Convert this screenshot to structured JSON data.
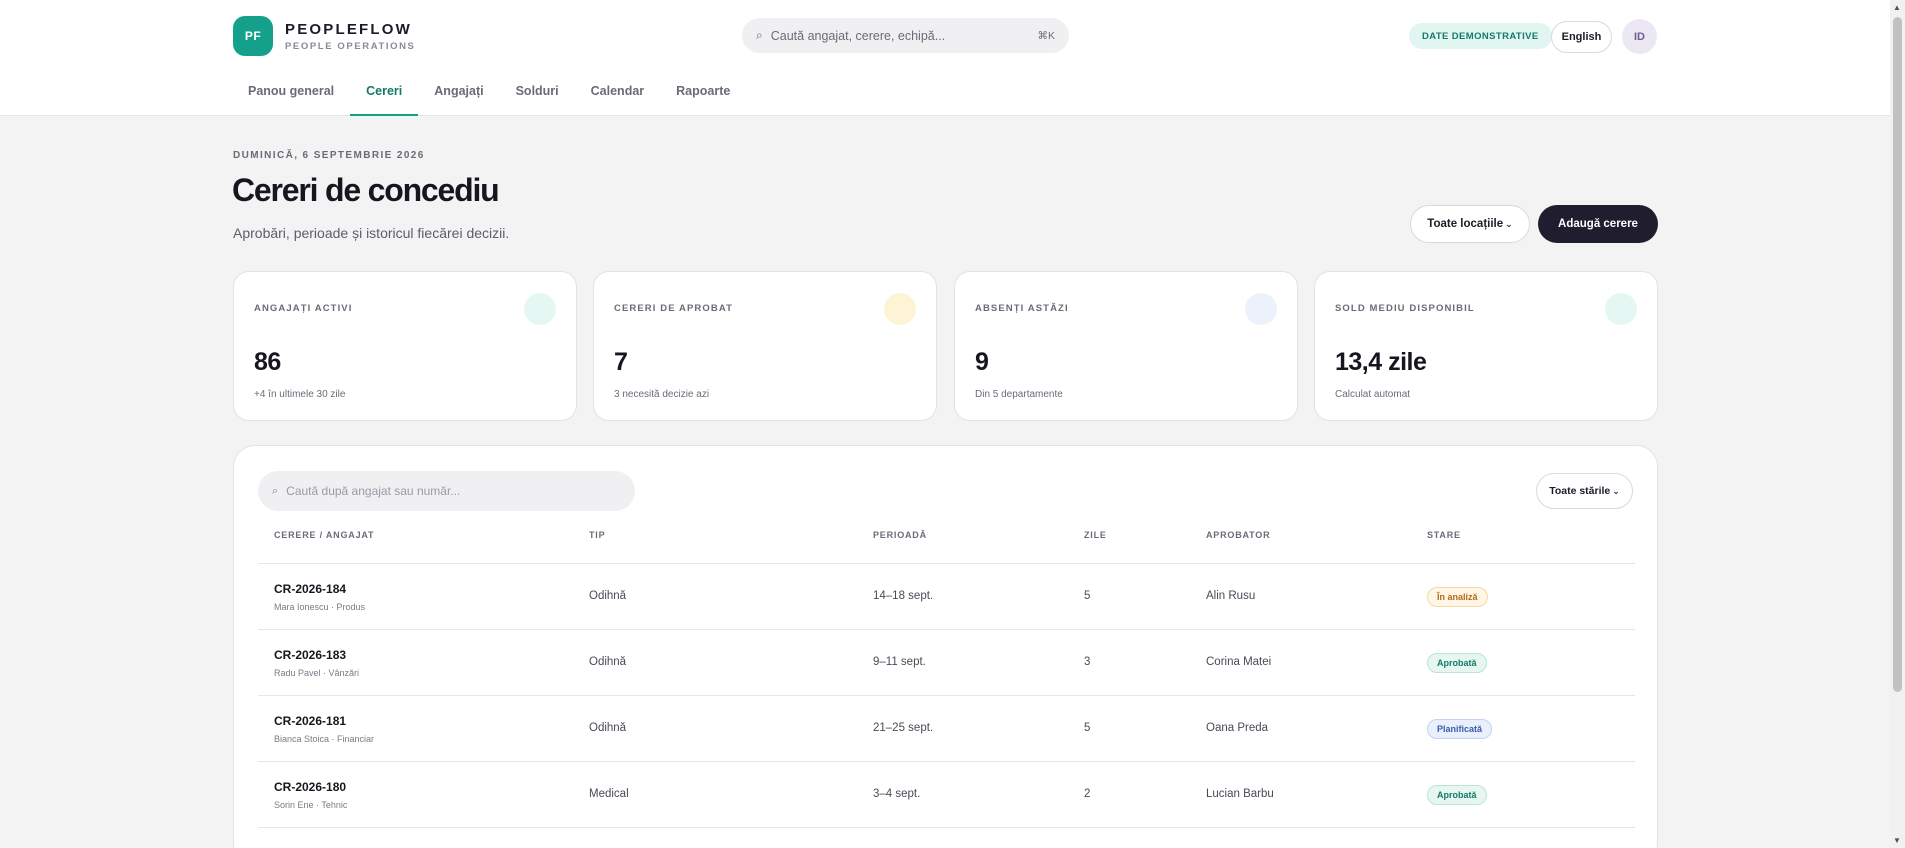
{
  "brand": {
    "logo": "PF",
    "name": "PEOPLEFLOW",
    "subtitle": "PEOPLE OPERATIONS"
  },
  "header": {
    "search_placeholder": "Caută angajat, cerere, echipă...",
    "search_shortcut": "⌘K",
    "demo_badge": "DATE DEMONSTRATIVE",
    "language": "English",
    "avatar": "ID"
  },
  "nav": [
    "Panou general",
    "Cereri",
    "Angajați",
    "Solduri",
    "Calendar",
    "Rapoarte"
  ],
  "nav_active": "Cereri",
  "page": {
    "date": "DUMINICĂ, 6 SEPTEMBRIE 2026",
    "title": "Cereri de concediu",
    "subtitle": "Aprobări, perioade și istoricul fiecărei decizii.",
    "locations_button": "Toate locațiile",
    "add_button": "Adaugă cerere"
  },
  "stats": [
    {
      "label": "ANGAJAȚI ACTIVI",
      "value": "86",
      "note": "+4 în ultimele 30 zile",
      "color": "#e5f7f2"
    },
    {
      "label": "CERERI DE APROBAT",
      "value": "7",
      "note": "3 necesită decizie azi",
      "color": "#fdf4d6"
    },
    {
      "label": "ABSENȚI ASTĂZI",
      "value": "9",
      "note": "Din 5 departamente",
      "color": "#ecf1fb"
    },
    {
      "label": "SOLD MEDIU DISPONIBIL",
      "value": "13,4 zile",
      "note": "Calculat automat",
      "color": "#e5f7f2"
    }
  ],
  "table": {
    "search_placeholder": "Caută după angajat sau număr...",
    "status_filter": "Toate stările",
    "columns": [
      "CERERE / ANGAJAT",
      "TIP",
      "PERIOADĂ",
      "ZILE",
      "APROBATOR",
      "STARE"
    ],
    "rows": [
      {
        "id": "CR-2026-184",
        "employee": "Mara Ionescu · Produs",
        "type": "Odihnă",
        "period": "14–18 sept.",
        "days": "5",
        "approver": "Alin Rusu",
        "status": "În analiză"
      },
      {
        "id": "CR-2026-183",
        "employee": "Radu Pavel · Vânzări",
        "type": "Odihnă",
        "period": "9–11 sept.",
        "days": "3",
        "approver": "Corina Matei",
        "status": "Aprobată"
      },
      {
        "id": "CR-2026-181",
        "employee": "Bianca Stoica · Financiar",
        "type": "Odihnă",
        "period": "21–25 sept.",
        "days": "5",
        "approver": "Oana Preda",
        "status": "Planificată"
      },
      {
        "id": "CR-2026-180",
        "employee": "Sorin Ene · Tehnic",
        "type": "Medical",
        "period": "3–4 sept.",
        "days": "2",
        "approver": "Lucian Barbu",
        "status": "Aprobată"
      }
    ]
  },
  "colors": {
    "accent": "#15a08b",
    "dark_button": "#1f1d2e",
    "background": "#f3f3f4"
  }
}
